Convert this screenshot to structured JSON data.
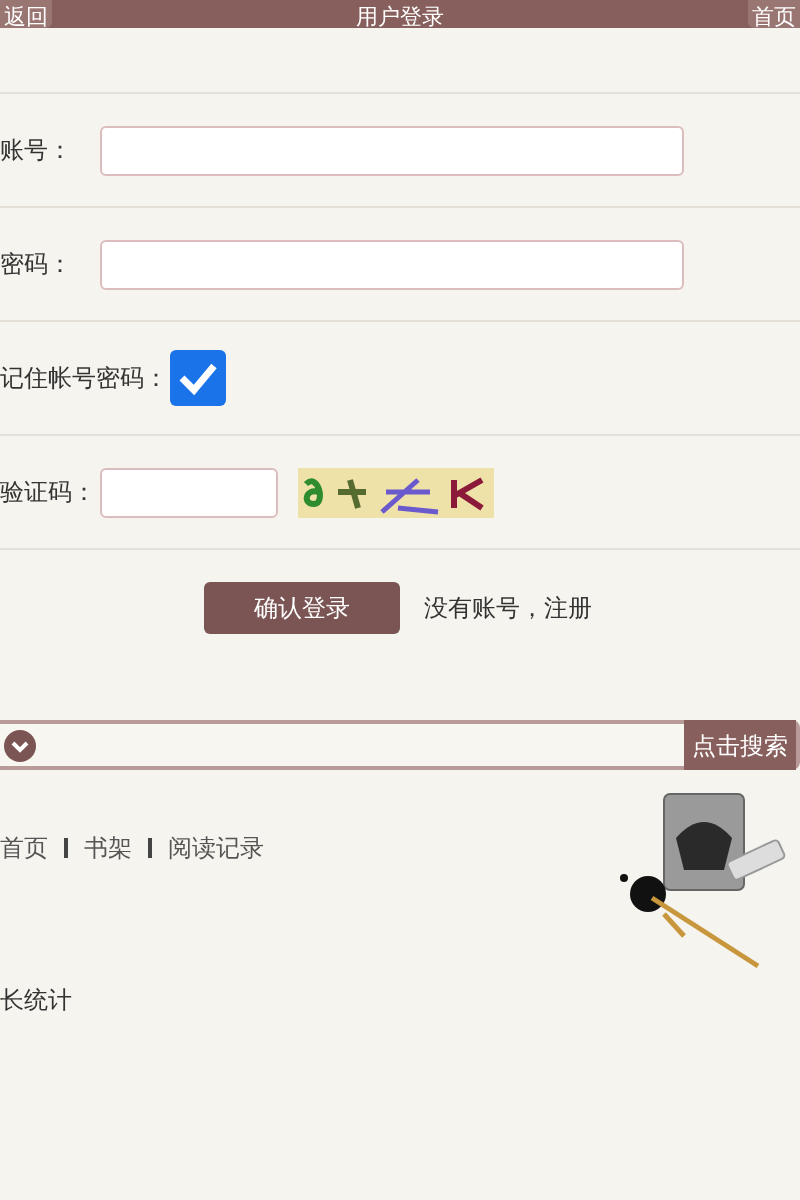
{
  "header": {
    "back": "返回",
    "title": "用户登录",
    "home": "首页"
  },
  "fields": [
    {
      "kind": "text",
      "label": "账号："
    },
    {
      "kind": "text",
      "label": "密码："
    },
    {
      "kind": "checkbox",
      "label": "记住帐号密码：",
      "checked": true
    },
    {
      "kind": "captcha",
      "label": "验证码："
    }
  ],
  "login_button": "确认登录",
  "register_link": "没有账号，注册",
  "search": {
    "button": "点击搜索"
  },
  "nav_links": [
    "首页",
    "书架",
    "阅读记录"
  ],
  "footer": "长统计"
}
